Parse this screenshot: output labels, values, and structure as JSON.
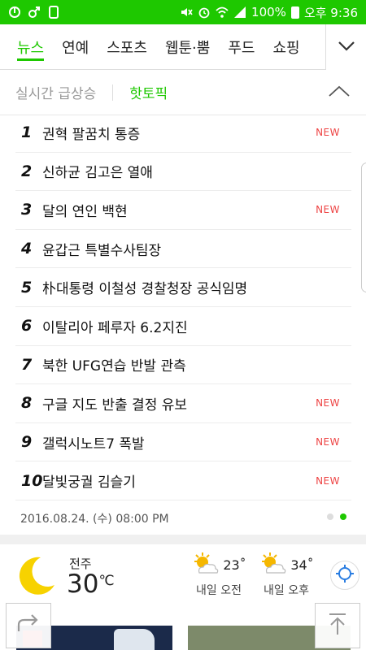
{
  "status_bar": {
    "battery": "100%",
    "time": "오후 9:36",
    "left_icons": [
      "notification-icon",
      "usb-icon",
      "device-icon"
    ],
    "right_icons": [
      "mute-icon",
      "alarm-icon",
      "wifi-icon",
      "signal-icon",
      "battery-icon"
    ]
  },
  "tabs": {
    "items": [
      "뉴스",
      "연예",
      "스포츠",
      "웹툰·뿜",
      "푸드",
      "쇼핑"
    ],
    "active": "뉴스"
  },
  "panel": {
    "tab_realtime": "실시간 급상승",
    "tab_hottopic": "핫토픽",
    "rows": [
      {
        "rank": "1",
        "keyword": "권혁 팔꿈치 통증",
        "badge": "NEW"
      },
      {
        "rank": "2",
        "keyword": "신하균 김고은 열애",
        "badge": ""
      },
      {
        "rank": "3",
        "keyword": "달의 연인 백현",
        "badge": "NEW"
      },
      {
        "rank": "4",
        "keyword": "윤갑근 특별수사팀장",
        "badge": ""
      },
      {
        "rank": "5",
        "keyword": "朴대통령 이철성 경찰청장 공식임명",
        "badge": ""
      },
      {
        "rank": "6",
        "keyword": "이탈리아 페루자 6.2지진",
        "badge": ""
      },
      {
        "rank": "7",
        "keyword": "북한 UFG연습 반발 관측",
        "badge": ""
      },
      {
        "rank": "8",
        "keyword": "구글 지도 반출 결정 유보",
        "badge": "NEW"
      },
      {
        "rank": "9",
        "keyword": "갤럭시노트7 폭발",
        "badge": "NEW"
      },
      {
        "rank": "10",
        "keyword": "달빛궁궐 김슬기",
        "badge": "NEW"
      }
    ],
    "timestamp": "2016.08.24. (수) 08:00 PM",
    "page_count": 2,
    "current_page": 2
  },
  "weather": {
    "city": "전주",
    "temp": "30",
    "unit": "℃",
    "forecast": [
      {
        "temp": "23˚",
        "label": "내일 오전",
        "icon": "partly-sunny-icon"
      },
      {
        "temp": "34˚",
        "label": "내일 오후",
        "icon": "partly-sunny-icon"
      }
    ],
    "current_icon": "moon-icon"
  },
  "colors": {
    "accent": "#1ec800",
    "new_badge": "#e44444",
    "sun": "#f5b700",
    "moon": "#f7d200"
  }
}
